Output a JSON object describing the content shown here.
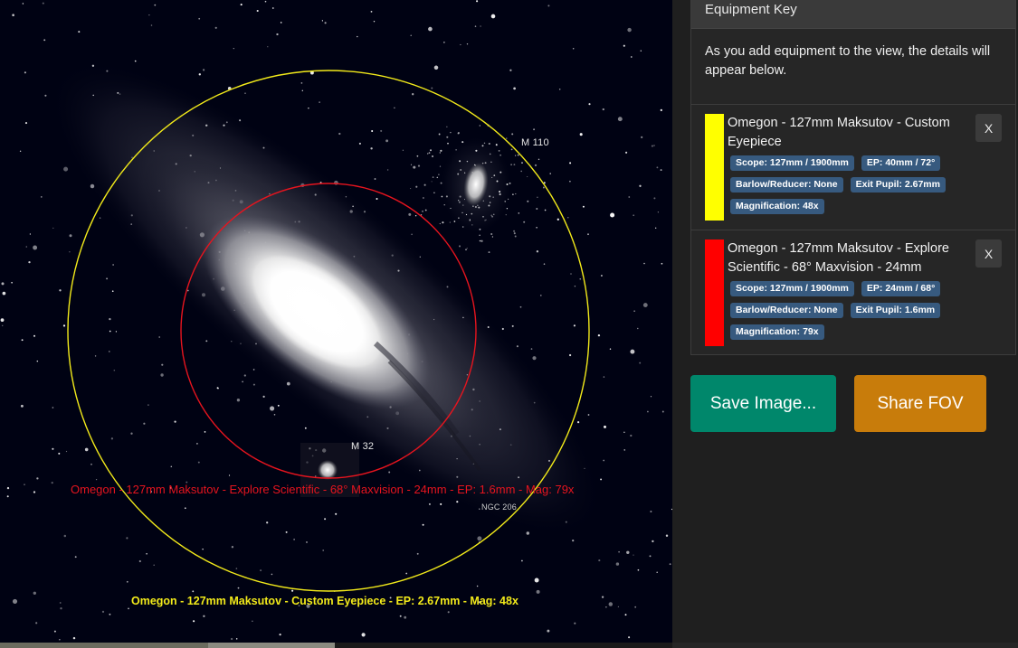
{
  "view": {
    "objects": [
      {
        "label": "M 110"
      },
      {
        "label": "M 32"
      },
      {
        "label": "NGC 206"
      }
    ],
    "fov_labels": {
      "red": "Omegon - 127mm Maksutov - Explore Scientific - 68° Maxvision - 24mm - EP: 1.6mm - Mag: 79x",
      "yellow": "Omegon - 127mm Maksutov - Custom Eyepiece - EP: 2.67mm - Mag: 48x"
    }
  },
  "key": {
    "header": "Equipment Key",
    "intro": "As you add equipment to the view, the details will appear below.",
    "items": [
      {
        "color": "#ffff00",
        "title": "Omegon - 127mm Maksutov - Custom Eyepiece",
        "remove_label": "X",
        "scope": "Scope: 127mm / 1900mm",
        "ep": "EP: 40mm / 72°",
        "barlow": "Barlow/Reducer: None",
        "exit_pupil": "Exit Pupil: 2.67mm",
        "magnification": "Magnification: 48x"
      },
      {
        "color": "#ff0000",
        "title": "Omegon - 127mm Maksutov - Explore Scientific - 68° Maxvision - 24mm",
        "remove_label": "X",
        "scope": "Scope: 127mm / 1900mm",
        "ep": "EP: 24mm / 68°",
        "barlow": "Barlow/Reducer: None",
        "exit_pupil": "Exit Pupil: 1.6mm",
        "magnification": "Magnification: 79x"
      }
    ]
  },
  "actions": {
    "save_label": "Save Image...",
    "share_label": "Share FOV"
  }
}
